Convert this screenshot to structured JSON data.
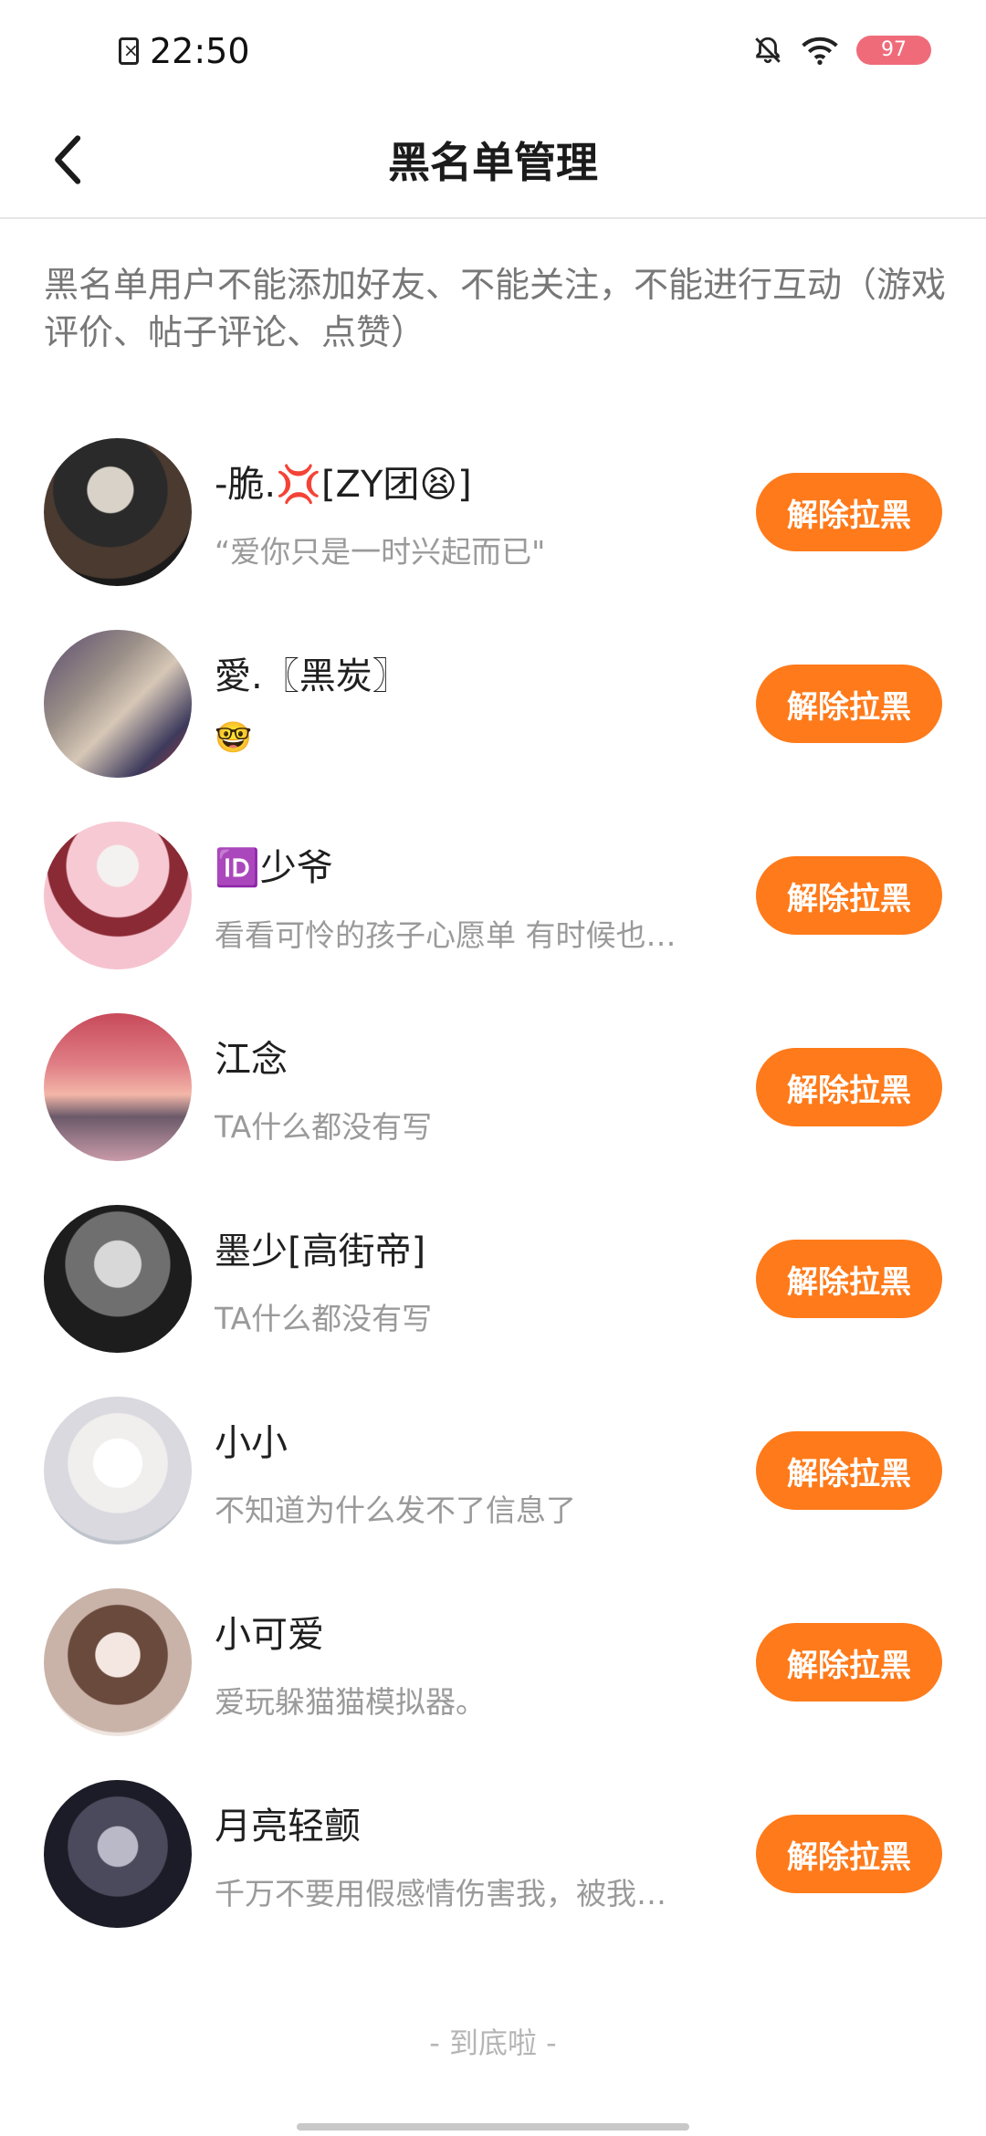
{
  "status_bar": {
    "time": "22:50",
    "battery": "97",
    "icons": [
      "sim-missing-icon",
      "bell-off-icon",
      "wifi-icon"
    ]
  },
  "header": {
    "title": "黑名单管理",
    "back_icon": "chevron-left-icon"
  },
  "description": "黑名单用户不能添加好友、不能关注，不能进行互动（游戏评价、帖子评论、点赞）",
  "colors": {
    "accent": "#ff7a1a",
    "battery": "#f06b7a"
  },
  "users": [
    {
      "name": "-脆.💢[ZY团😫]",
      "bio": "“爱你只是一时兴起而已\"",
      "button": "解除拉黑"
    },
    {
      "name": "愛.〖黑炭〗",
      "bio": "🤓",
      "button": "解除拉黑"
    },
    {
      "name": "🆔少爷",
      "bio": "看看可怜的孩子心愿单  有时候也…",
      "button": "解除拉黑"
    },
    {
      "name": "江念",
      "bio": "TA什么都没有写",
      "button": "解除拉黑"
    },
    {
      "name": "墨少[高街帝]",
      "bio": "TA什么都没有写",
      "button": "解除拉黑"
    },
    {
      "name": "小小",
      "bio": "不知道为什么发不了信息了",
      "button": "解除拉黑"
    },
    {
      "name": "小可爱",
      "bio": "爱玩躲猫猫模拟器。",
      "button": "解除拉黑"
    },
    {
      "name": "月亮轻颤",
      "bio": "千万不要用假感情伤害我，被我…",
      "button": "解除拉黑"
    }
  ],
  "footer": {
    "end_text": "-  到底啦  -"
  }
}
